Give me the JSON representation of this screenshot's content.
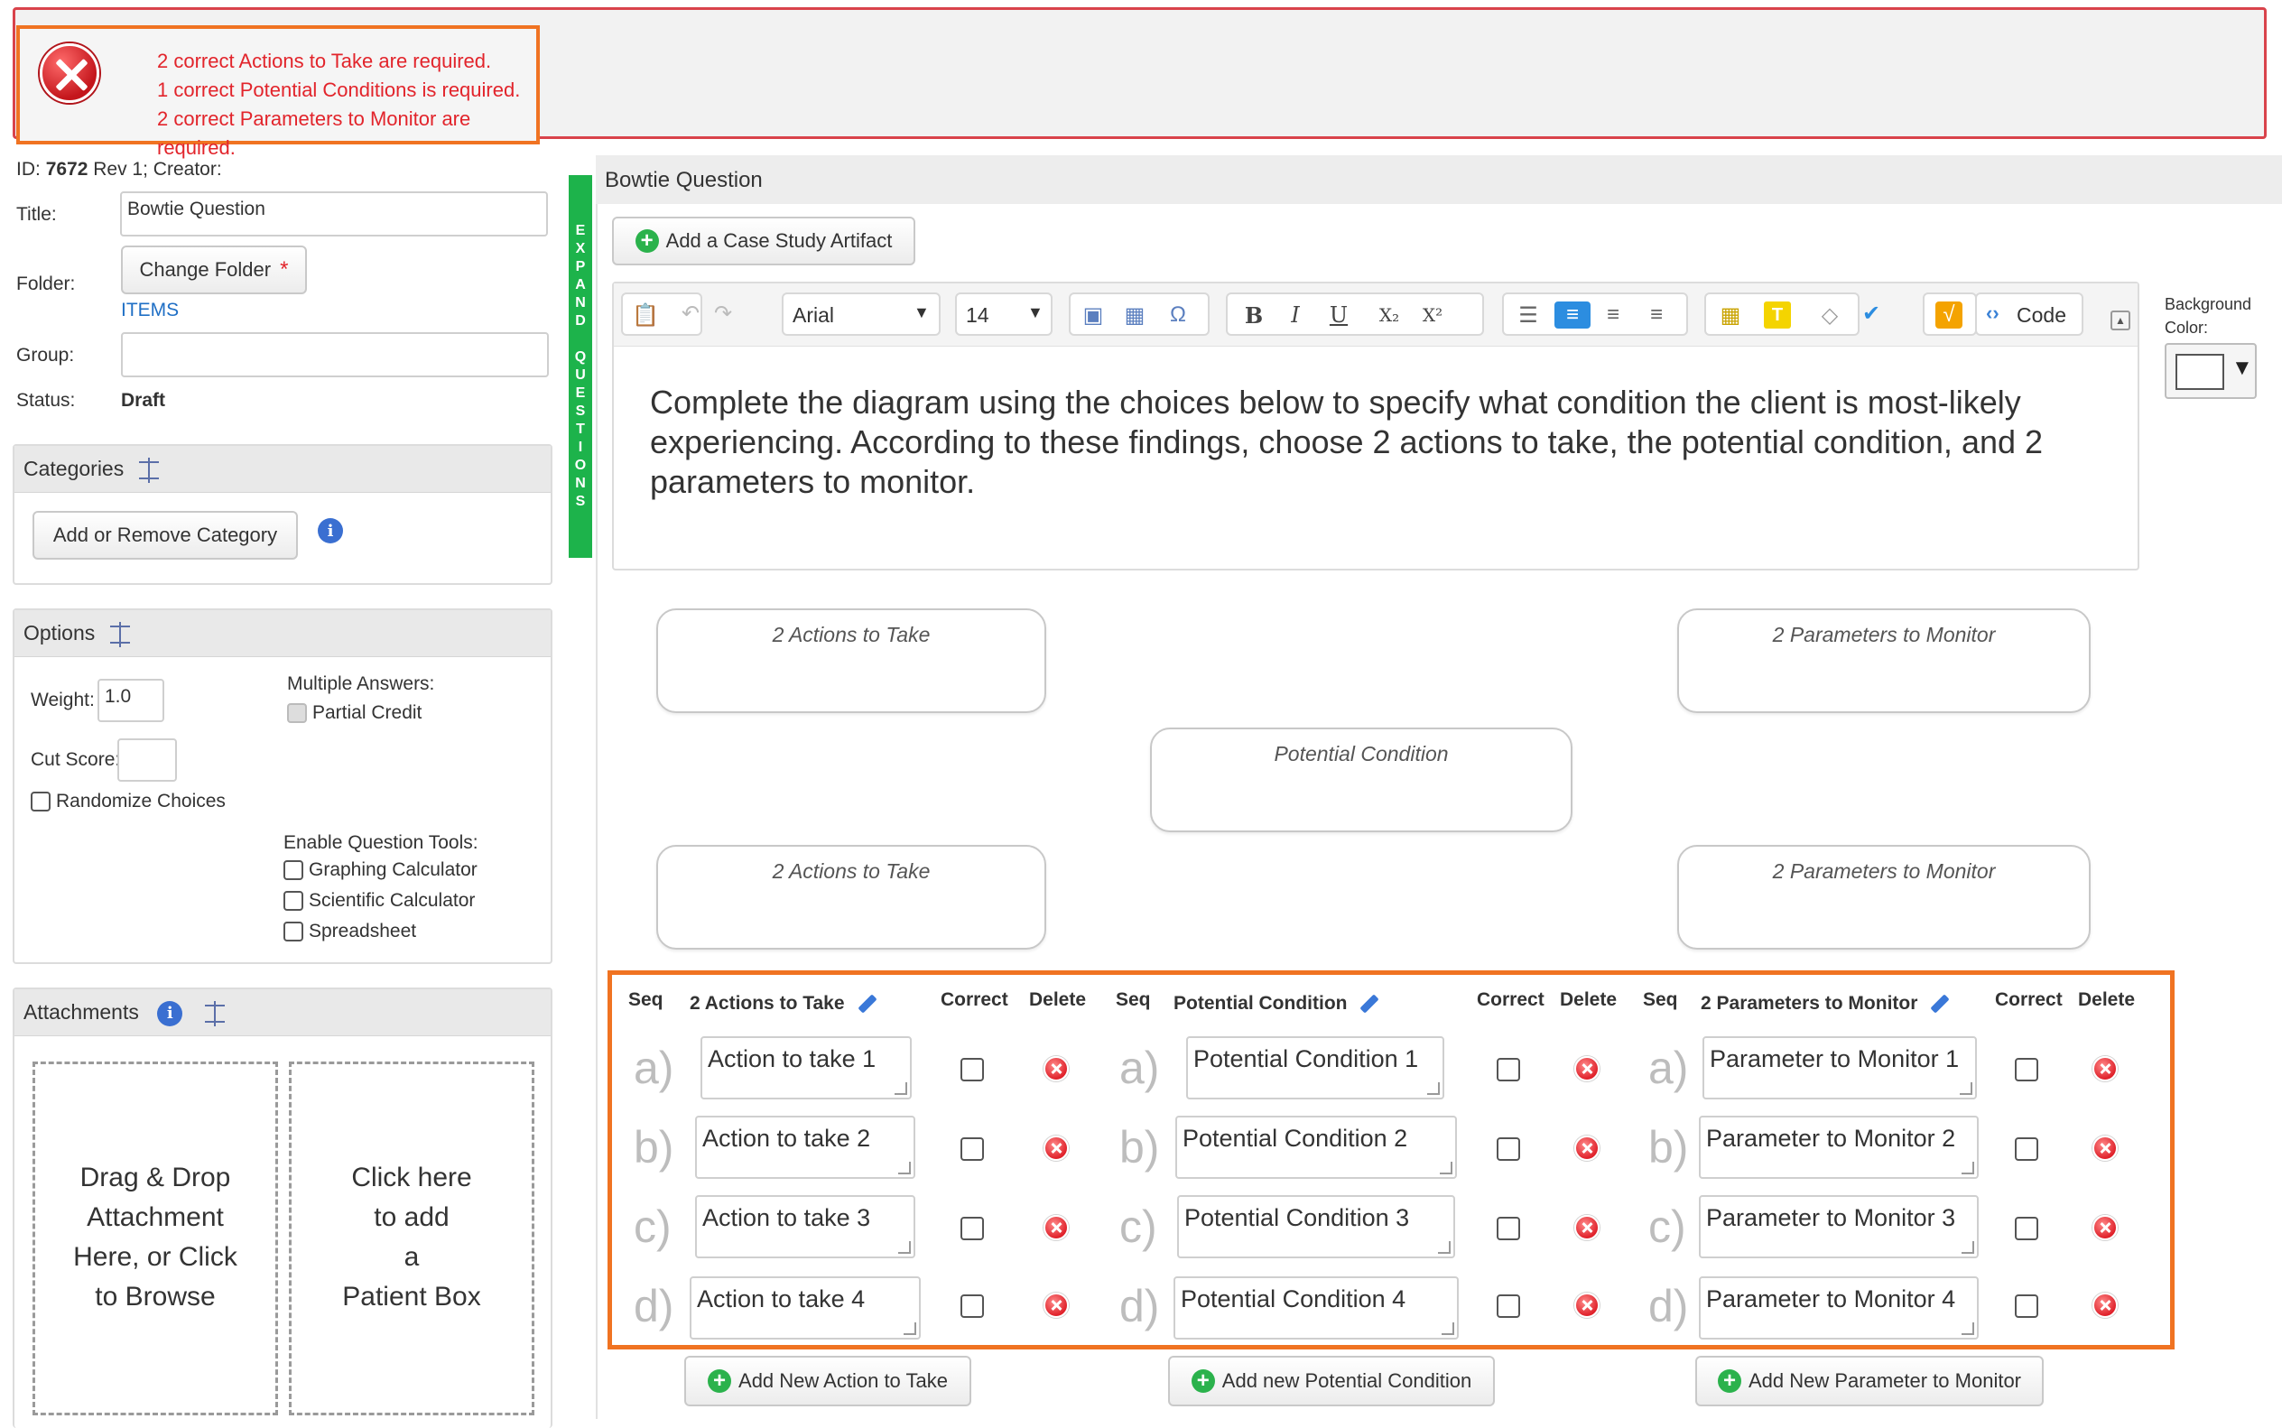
{
  "errors": {
    "lines": [
      "2 correct Actions to Take are required.",
      "1 correct Potential Conditions is required.",
      "2 correct Parameters to Monitor are required."
    ]
  },
  "meta": {
    "id_label": "ID:",
    "id_value": "7672",
    "rev": "Rev 1;",
    "creator": "Creator:"
  },
  "form": {
    "title_label": "Title:",
    "title_value": "Bowtie Question",
    "folder_label": "Folder:",
    "change_folder": "Change Folder",
    "folder_required": "*",
    "folder_value": "ITEMS",
    "group_label": "Group:",
    "group_value": "",
    "status_label": "Status:",
    "status_value": "Draft"
  },
  "categories": {
    "title": "Categories",
    "add_remove": "Add or Remove Category"
  },
  "options": {
    "title": "Options",
    "weight_label": "Weight:",
    "weight_value": "1.0",
    "multiple_answers": "Multiple Answers:",
    "partial_credit": "Partial Credit",
    "cut_score_label": "Cut Score:",
    "cut_score_value": "",
    "randomize": "Randomize Choices",
    "enable_tools": "Enable Question Tools:",
    "tools": [
      "Graphing Calculator",
      "Scientific Calculator",
      "Spreadsheet"
    ]
  },
  "attachments": {
    "title": "Attachments",
    "drop_lines": [
      "Drag & Drop",
      "Attachment",
      "Here, or Click",
      "to Browse"
    ],
    "patient_lines": [
      "Click here",
      "to add",
      "a",
      "Patient Box"
    ]
  },
  "expand": {
    "letters": [
      "E",
      "X",
      "P",
      "A",
      "N",
      "D",
      "",
      "Q",
      "U",
      "E",
      "S",
      "T",
      "I",
      "O",
      "N",
      "S"
    ]
  },
  "main": {
    "header": "Bowtie Question",
    "add_artifact": "Add a Case Study Artifact",
    "font_name": "Arial",
    "font_size": "14",
    "code_label": "Code",
    "bg_color_label1": "Background",
    "bg_color_label2": "Color:",
    "prompt": "Complete the diagram using the choices below to specify what condition the client is most-likely experiencing. According to these findings, choose 2 actions to take, the potential condition, and 2 parameters to monitor."
  },
  "diagram": {
    "actions_top": "2 Actions to Take",
    "params_top": "2 Parameters to Monitor",
    "condition": "Potential Condition",
    "actions_bottom": "2 Actions to Take",
    "params_bottom": "2 Parameters to Monitor"
  },
  "table": {
    "seq": "Seq",
    "correct": "Correct",
    "delete": "Delete",
    "col_actions": "2 Actions to Take",
    "col_condition": "Potential Condition",
    "col_params": "2 Parameters to Monitor",
    "seq_letters": [
      "a)",
      "b)",
      "c)",
      "d)"
    ],
    "actions": [
      "Action to take 1",
      "Action to take 2",
      "Action to take 3",
      "Action to take 4"
    ],
    "conditions": [
      "Potential Condition 1",
      "Potential Condition 2",
      "Potential Condition 3",
      "Potential Condition 4"
    ],
    "params": [
      "Parameter to Monitor 1",
      "Parameter to Monitor 2",
      "Parameter to Monitor 3",
      "Parameter to Monitor 4"
    ]
  },
  "buttons": {
    "add_action": "Add New Action to Take",
    "add_condition": "Add new Potential Condition",
    "add_param": "Add New Parameter to Monitor"
  },
  "colors": {
    "error_red": "#e2242b",
    "highlight_orange": "#f07322",
    "expand_green": "#1db34b",
    "link_blue": "#1f6fc5"
  }
}
